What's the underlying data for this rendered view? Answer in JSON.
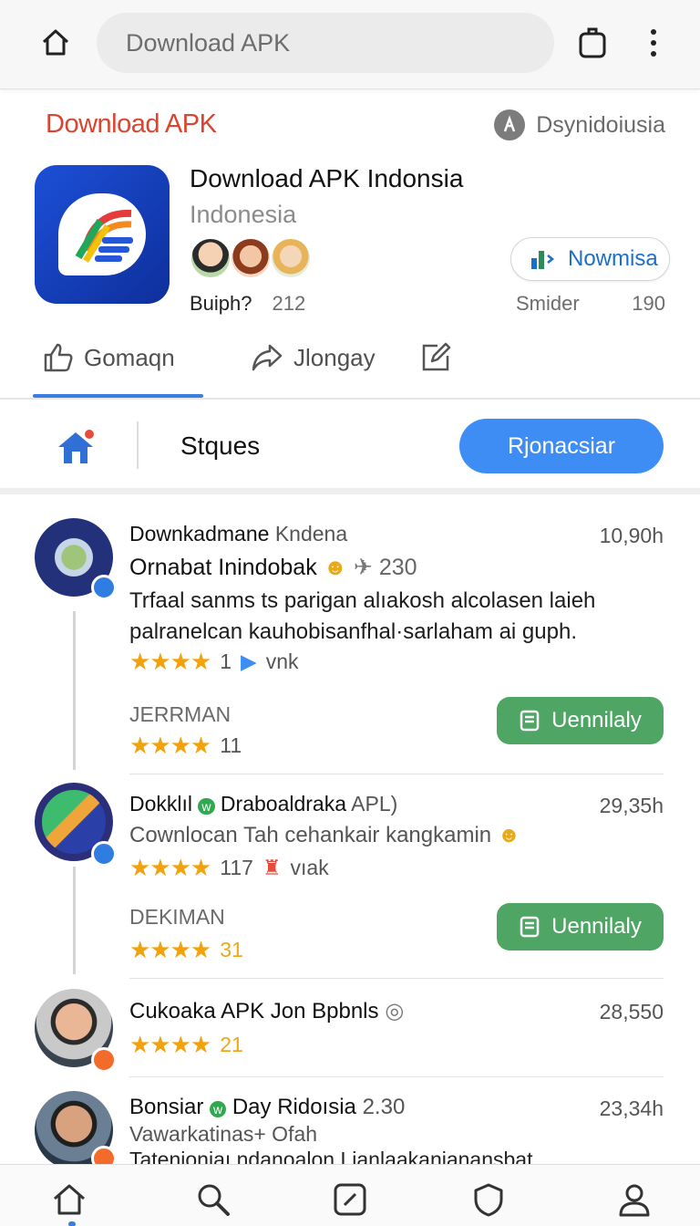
{
  "browser": {
    "url_text": "Download APK",
    "icons": [
      "home-icon",
      "tabs-icon",
      "more-vertical-icon"
    ]
  },
  "header": {
    "brand": "Download APK",
    "developer": "Dsynidoiusia"
  },
  "app": {
    "title": "Download APK Indonsia",
    "subtitle": "Indonesia",
    "meta_label": "Buiph?",
    "meta_value": "212",
    "chip_label": "Nowmisa",
    "side_label": "Smider",
    "side_value": "190"
  },
  "actions": [
    {
      "label": "Gomaqn",
      "icon": "thumbs-up-icon"
    },
    {
      "label": "Jlongay",
      "icon": "share-icon"
    },
    {
      "label": "",
      "icon": "edit-icon"
    }
  ],
  "toolbar": {
    "section_label": "Stques",
    "primary_button": "Rjonacsiar"
  },
  "posts": [
    {
      "name": "Downkadmane",
      "name_extra": "Kndena",
      "time": "10,90h",
      "headline": "Ornabat Inindobak",
      "headline_extra": "230",
      "body": "Trfaal sanms ts parigan alıakosh alcolasen laieh palranelcan kauhobisanfhal·sarlaham ai guph.",
      "stars": "★★★★",
      "rating_count": "1",
      "rating_extra": "vnk",
      "category": "JERRMAN",
      "category_stars": "★★★★",
      "category_count": "11",
      "install_label": "Uennilaly"
    },
    {
      "name": "Dokklıl",
      "name_extra": "Draboaldraka",
      "name_tail": "APL)",
      "time": "29,35h",
      "headline": "Cownlocan Tah cehankair kangkamin",
      "stars": "★★★★",
      "rating_count": "117",
      "rating_extra": "vıak",
      "category": "DEKIMAN",
      "category_stars": "★★★★",
      "category_count": "31",
      "install_label": "Uennilaly"
    },
    {
      "name": "Cukoaka APK Jon Bpbnls",
      "time": "28,550",
      "stars": "★★★★",
      "rating_count": "21"
    },
    {
      "name": "Bonsiar",
      "name_extra": "Day Ridoısia",
      "name_tail": "2.30",
      "time": "23,34h",
      "subline": "Vawarkatinas+ Ofah",
      "body_cut": "Tatenioniaı ndanoalon Ljanlaakanianansbat."
    }
  ],
  "bottom_nav": [
    "home-icon",
    "search-icon",
    "edit-square-icon",
    "shield-icon",
    "profile-icon"
  ],
  "colors": {
    "brand_red": "#d9452f",
    "accent_blue": "#3d8df5",
    "install_green": "#4fa664",
    "star_gold": "#f2a20c"
  }
}
